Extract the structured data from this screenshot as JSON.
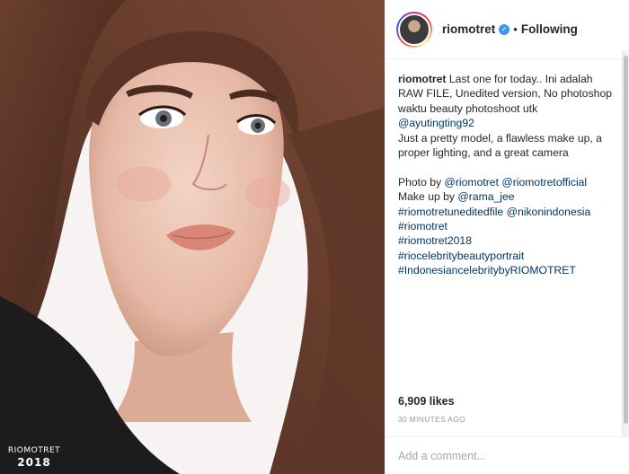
{
  "photo": {
    "alt": "Portrait photo",
    "watermark_line1": "RIOMOTRET",
    "watermark_line2": "2018"
  },
  "header": {
    "username": "riomotret",
    "verified_icon": "verified-badge-icon",
    "separator": "•",
    "follow_status": "Following"
  },
  "caption": {
    "author": "riomotret",
    "first_line": " Last one for today.. Ini adalah",
    "lines": [
      "RAW FILE, Unedited version, No photoshop",
      "waktu beauty photoshoot utk"
    ],
    "mention_model": "@ayutingting92",
    "lines2": [
      "Just a pretty model, a flawless make up, a",
      "proper lighting, and a great camera"
    ],
    "photo_by_label": "Photo by ",
    "photo_by_1": "@riomotret",
    "photo_by_2": "@riomotretofficial",
    "makeup_label": "Make up by ",
    "makeup_by": "@rama_jee",
    "hashtag_1": "#riomotretuneditedfile",
    "mention_nikon": "@nikonindonesia",
    "hashtags": [
      "#riomotret",
      "#riomotret2018",
      "#riocelebritybeautyportrait",
      "#IndonesiancelebritybyRIOMOTRET"
    ]
  },
  "stats": {
    "likes": "6,909 likes",
    "time_ago": "30 MINUTES AGO"
  },
  "comment": {
    "placeholder": "Add a comment..."
  },
  "colors": {
    "link": "#003569",
    "verified": "#3897f0",
    "muted": "#999999",
    "border": "#efefef"
  }
}
